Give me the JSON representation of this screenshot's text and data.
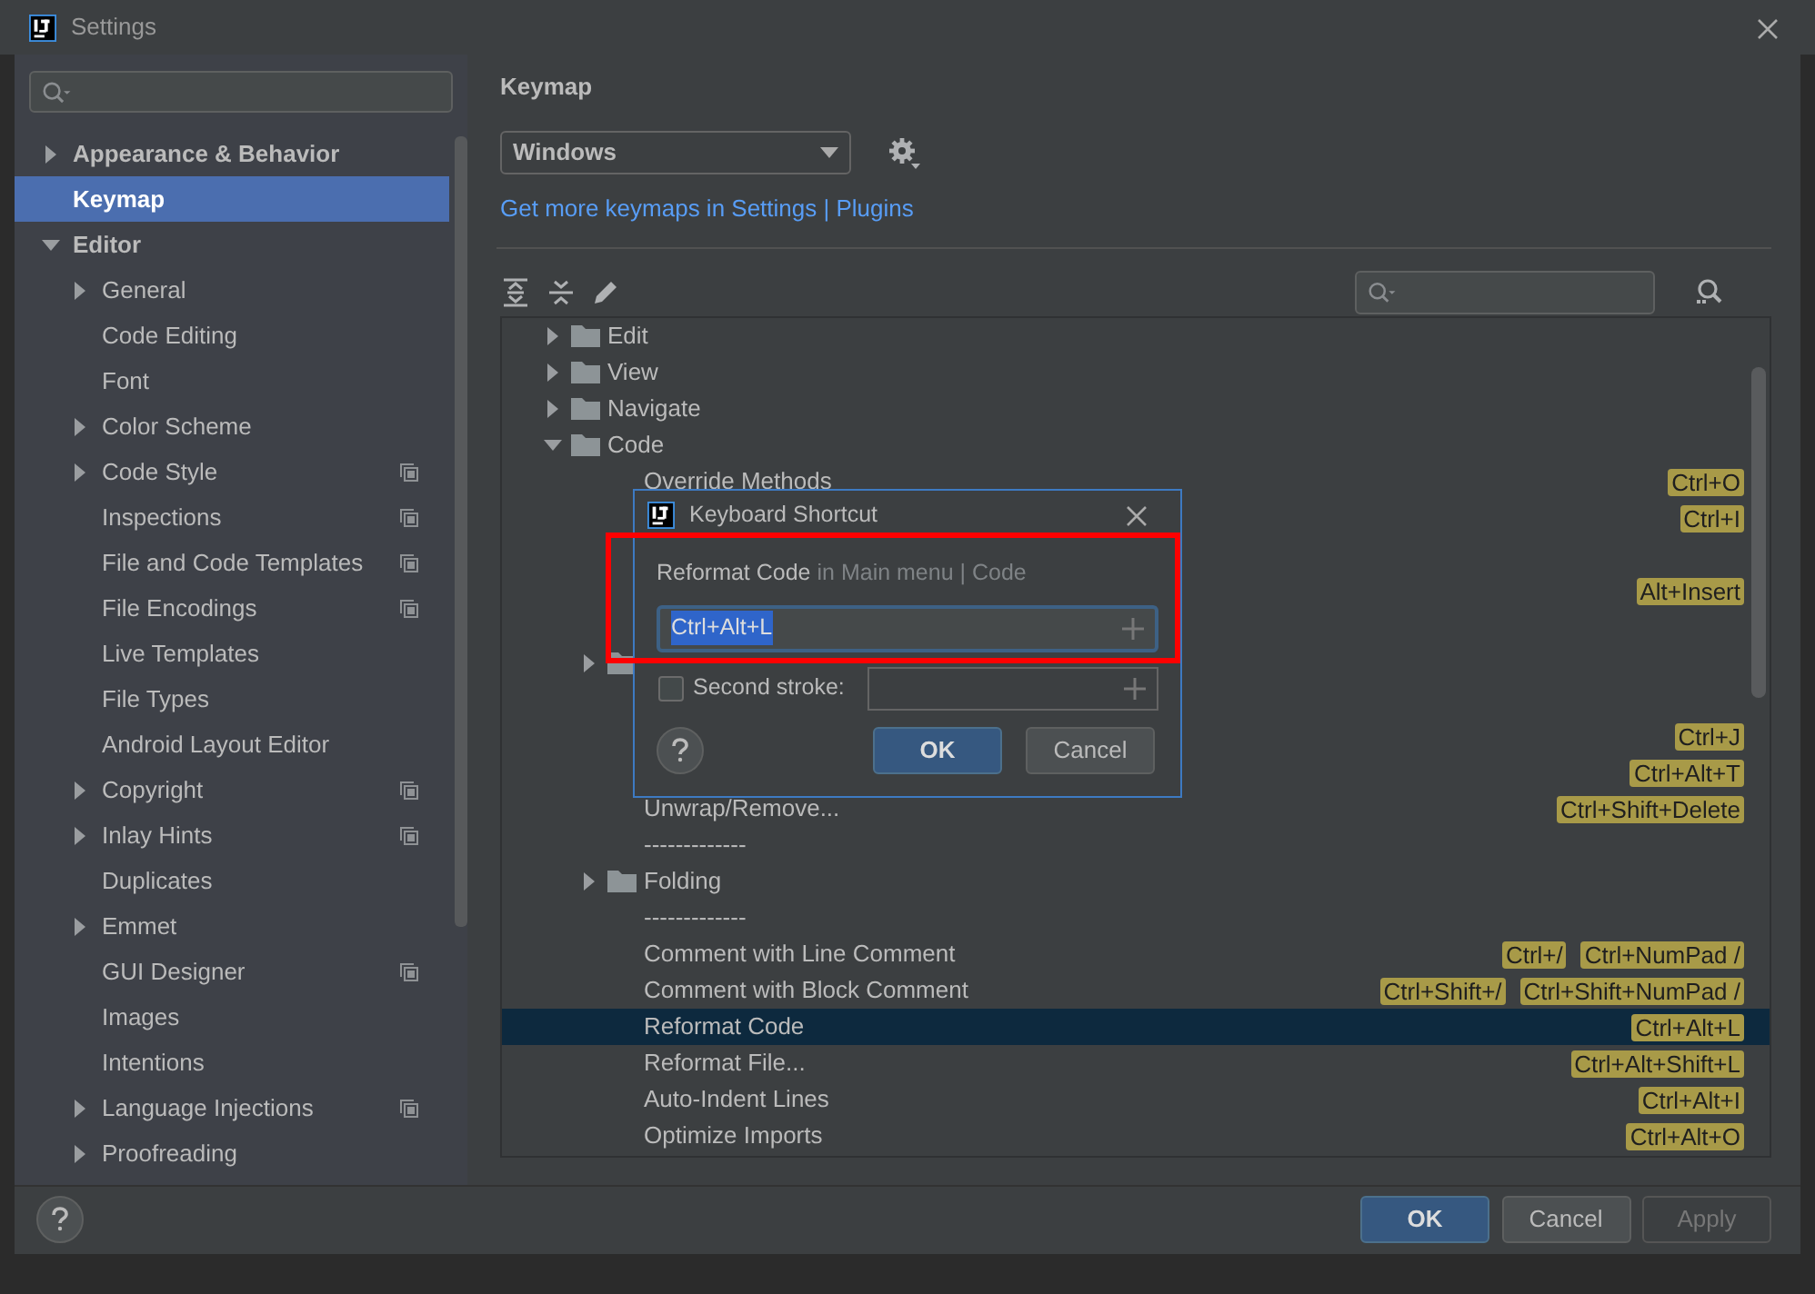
{
  "window": {
    "title": "Settings"
  },
  "sidebar": {
    "items": [
      {
        "label": "Appearance & Behavior",
        "expanded": false,
        "selected": false
      },
      {
        "label": "Keymap",
        "selected": true
      },
      {
        "label": "Editor",
        "expanded": true,
        "selected": false,
        "children": [
          {
            "label": "General",
            "expanded": false,
            "selected": false,
            "project_level": false
          },
          {
            "label": "Code Editing",
            "selected": false,
            "project_level": false
          },
          {
            "label": "Font",
            "selected": false,
            "project_level": false
          },
          {
            "label": "Color Scheme",
            "expanded": false,
            "selected": false,
            "project_level": false
          },
          {
            "label": "Code Style",
            "expanded": false,
            "selected": false,
            "project_level": true
          },
          {
            "label": "Inspections",
            "selected": false,
            "project_level": true
          },
          {
            "label": "File and Code Templates",
            "selected": false,
            "project_level": true
          },
          {
            "label": "File Encodings",
            "selected": false,
            "project_level": true
          },
          {
            "label": "Live Templates",
            "selected": false,
            "project_level": false
          },
          {
            "label": "File Types",
            "selected": false,
            "project_level": false
          },
          {
            "label": "Android Layout Editor",
            "selected": false,
            "project_level": false
          },
          {
            "label": "Copyright",
            "expanded": false,
            "selected": false,
            "project_level": true
          },
          {
            "label": "Inlay Hints",
            "expanded": false,
            "selected": false,
            "project_level": true
          },
          {
            "label": "Duplicates",
            "selected": false,
            "project_level": false
          },
          {
            "label": "Emmet",
            "expanded": false,
            "selected": false,
            "project_level": false
          },
          {
            "label": "GUI Designer",
            "selected": false,
            "project_level": true
          },
          {
            "label": "Images",
            "selected": false,
            "project_level": false
          },
          {
            "label": "Intentions",
            "selected": false,
            "project_level": false
          },
          {
            "label": "Language Injections",
            "expanded": false,
            "selected": false,
            "project_level": true
          },
          {
            "label": "Proofreading",
            "expanded": false,
            "selected": false,
            "project_level": false
          }
        ]
      }
    ]
  },
  "keymap": {
    "heading": "Keymap",
    "scheme": "Windows",
    "link": "Get more keymaps in Settings | Plugins",
    "tree": [
      {
        "kind": "folder",
        "name": "Edit",
        "expanded": false
      },
      {
        "kind": "folder",
        "name": "View",
        "expanded": false
      },
      {
        "kind": "folder",
        "name": "Navigate",
        "expanded": false
      },
      {
        "kind": "folder",
        "name": "Code",
        "expanded": true,
        "children": [
          {
            "kind": "action",
            "name": "Override Methods",
            "shortcuts": [
              "Ctrl+O"
            ],
            "selected": false
          },
          {
            "kind": "action",
            "shortcuts": [
              "Ctrl+I"
            ],
            "selected": false
          },
          {
            "kind": "action",
            "selected": false
          },
          {
            "kind": "action",
            "shortcuts": [
              "Alt+Insert"
            ],
            "selected": false
          },
          {
            "kind": "action",
            "selected": false
          },
          {
            "kind": "folder",
            "expanded": false
          },
          {
            "kind": "action",
            "selected": false
          },
          {
            "kind": "action",
            "shortcuts": [
              "Ctrl+J"
            ],
            "selected": false
          },
          {
            "kind": "action",
            "shortcuts": [
              "Ctrl+Alt+T"
            ],
            "selected": false
          },
          {
            "kind": "action",
            "name": "Unwrap/Remove...",
            "shortcuts": [
              "Ctrl+Shift+Delete"
            ],
            "selected": false
          },
          {
            "kind": "separator",
            "name": "-------------"
          },
          {
            "kind": "folder",
            "name": "Folding",
            "expanded": false
          },
          {
            "kind": "separator",
            "name": "-------------"
          },
          {
            "kind": "action",
            "name": "Comment with Line Comment",
            "shortcuts": [
              "Ctrl+/",
              "Ctrl+NumPad /"
            ],
            "selected": false
          },
          {
            "kind": "action",
            "name": "Comment with Block Comment",
            "shortcuts": [
              "Ctrl+Shift+/",
              "Ctrl+Shift+NumPad /"
            ],
            "selected": false
          },
          {
            "kind": "action",
            "name": "Reformat Code",
            "shortcuts": [
              "Ctrl+Alt+L"
            ],
            "selected": true
          },
          {
            "kind": "action",
            "name": "Reformat File...",
            "shortcuts": [
              "Ctrl+Alt+Shift+L"
            ],
            "selected": false
          },
          {
            "kind": "action",
            "name": "Auto-Indent Lines",
            "shortcuts": [
              "Ctrl+Alt+I"
            ],
            "selected": false
          },
          {
            "kind": "action",
            "name": "Optimize Imports",
            "shortcuts": [
              "Ctrl+Alt+O"
            ],
            "selected": false
          }
        ]
      }
    ]
  },
  "shortcut_dialog": {
    "title": "Keyboard Shortcut",
    "action": "Reformat Code",
    "context": "in Main menu | Code",
    "first_stroke": "Ctrl+Alt+L",
    "second_stroke": {
      "label": "Second stroke:",
      "checked": false
    },
    "buttons": [
      {
        "label": "OK",
        "default": true
      },
      {
        "label": "Cancel",
        "default": false
      }
    ]
  },
  "footer": {
    "buttons": [
      {
        "label": "OK",
        "default": true,
        "disabled": false
      },
      {
        "label": "Cancel",
        "default": false,
        "disabled": false
      },
      {
        "label": "Apply",
        "default": false,
        "disabled": true
      }
    ]
  }
}
